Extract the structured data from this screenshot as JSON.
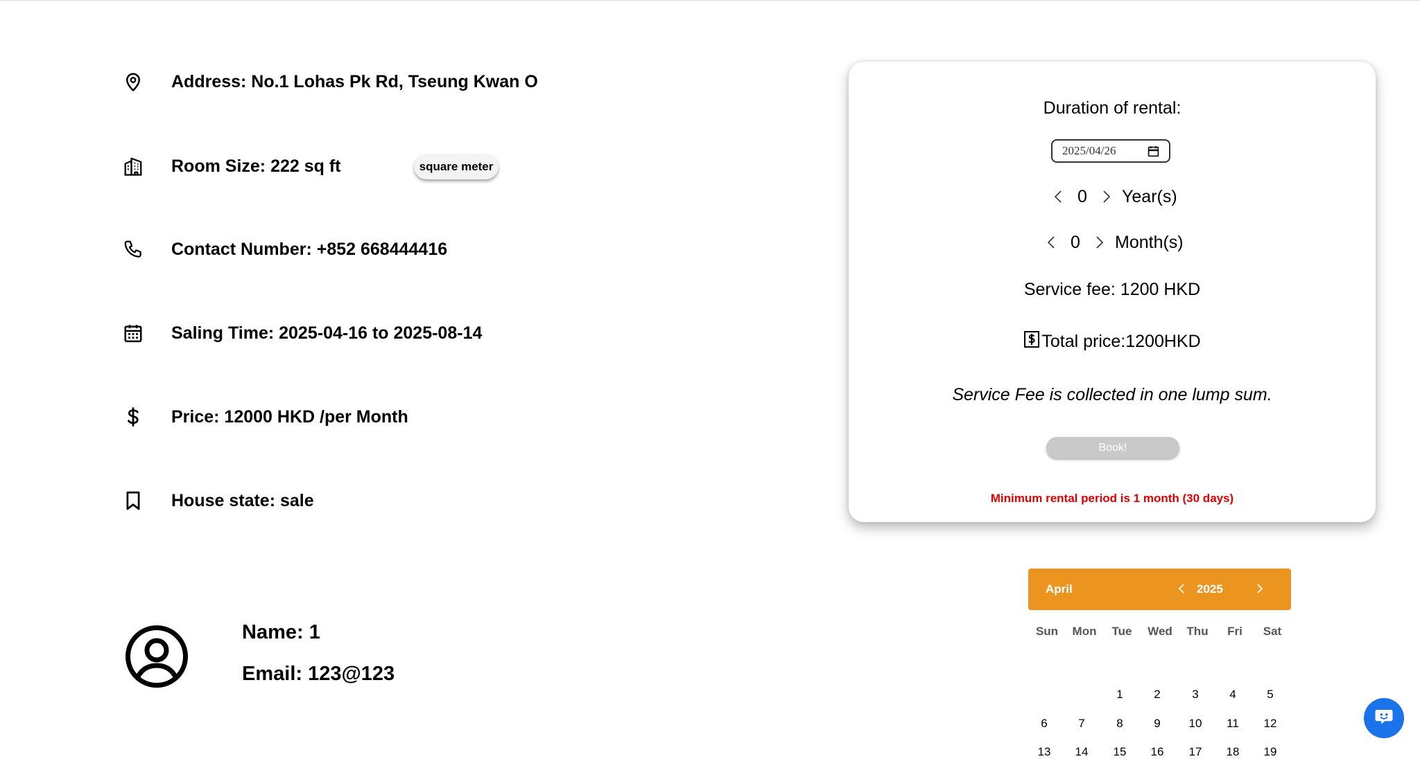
{
  "details": {
    "address": "Address: No.1 Lohas Pk Rd, Tseung Kwan O",
    "room_size": "Room Size: 222 sq ft",
    "unit_toggle": "square meter",
    "contact": "Contact Number: +852 668444416",
    "saling_time": "Saling Time: 2025-04-16 to 2025-08-14",
    "price": "Price: 12000 HKD /per Month",
    "house_state": "House state: sale"
  },
  "icons": {
    "address": "map-pin-icon",
    "room_size": "building-icon",
    "contact": "phone-icon",
    "saling_time": "calendar-icon",
    "price": "dollar-icon",
    "house_state": "bookmark-icon",
    "owner": "user-circle-icon",
    "chat": "chat-bot-icon"
  },
  "owner": {
    "name": "Name: 1",
    "email": "Email: 123@123"
  },
  "rental": {
    "title": "Duration of rental:",
    "start_date": "2025/04/26",
    "years_value": "0",
    "years_label": "Year(s)",
    "months_value": "0",
    "months_label": "Month(s)",
    "service_fee": "Service fee: 1200 HKD",
    "total_price": "Total price:1200HKD",
    "note": "Service Fee is collected in one lump sum.",
    "book_label": "Book!",
    "warning": "Minimum rental period is 1 month (30 days)"
  },
  "calendar": {
    "month": "April",
    "year": "2025",
    "weekdays": [
      "Sun",
      "Mon",
      "Tue",
      "Wed",
      "Thu",
      "Fri",
      "Sat"
    ],
    "week1": [
      "1",
      "2",
      "3",
      "4",
      "5"
    ],
    "week2": [
      "6",
      "7",
      "8",
      "9",
      "10",
      "11",
      "12"
    ],
    "week3": [
      "13",
      "14",
      "15",
      "16",
      "17",
      "18",
      "19"
    ]
  },
  "colors": {
    "calendar_header": "#eb941f",
    "warning": "#e10000",
    "chat_button": "#1a73e8",
    "book_button_disabled": "#c9c9c9"
  }
}
